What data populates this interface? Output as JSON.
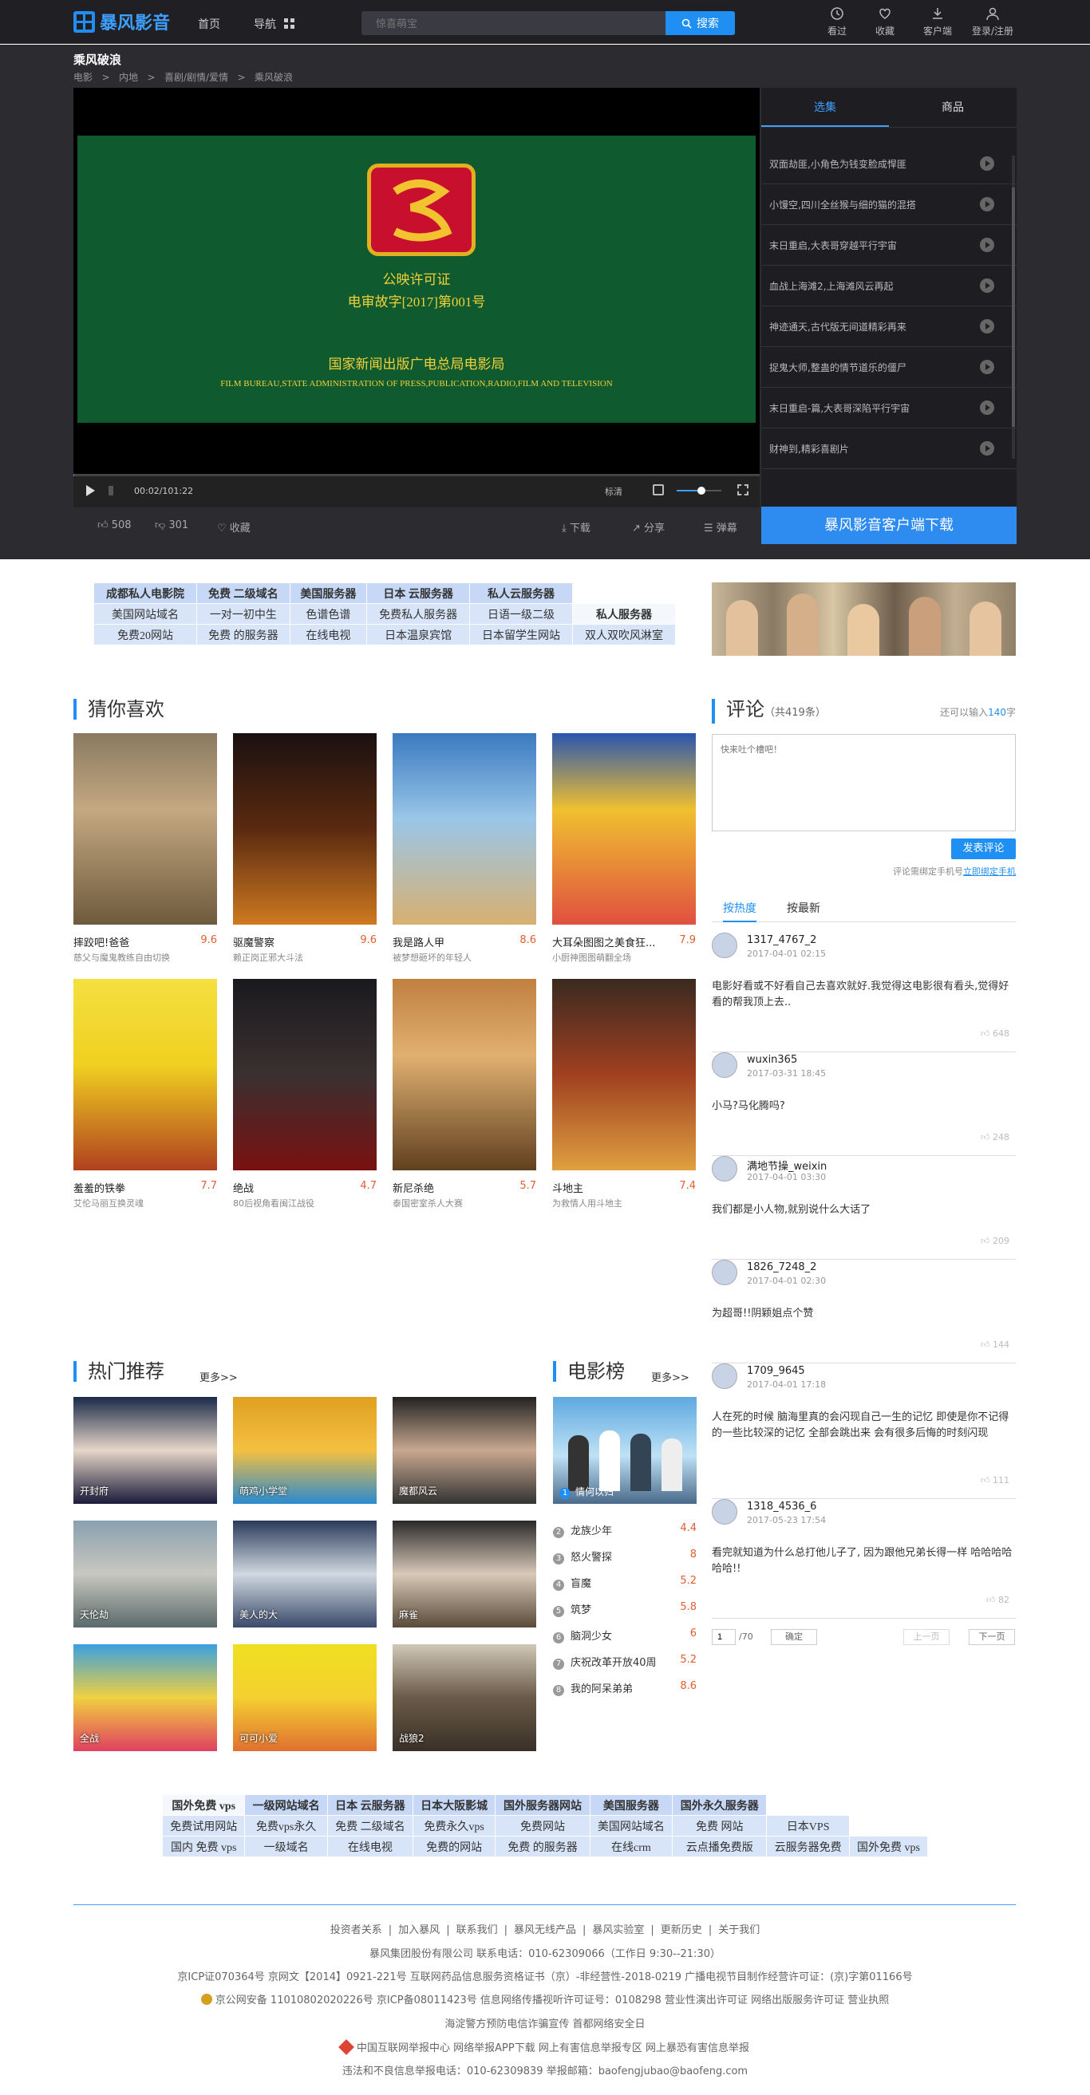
{
  "header": {
    "brand": "暴风影音",
    "nav_home": "首页",
    "nav_guide": "导航",
    "search_placeholder": "惊喜萌宝",
    "search_button": "搜索",
    "icons": [
      {
        "label": "看过",
        "icon": "clock-icon"
      },
      {
        "label": "收藏",
        "icon": "heart-icon"
      },
      {
        "label": "客户端",
        "icon": "download-icon"
      },
      {
        "label": "登录/注册",
        "icon": "user-icon"
      }
    ]
  },
  "page": {
    "title": "乘风破浪",
    "breadcrumb": [
      "电影",
      ">",
      "内地",
      ">",
      "喜剧/剧情/爱情",
      ">",
      "乘风破浪"
    ]
  },
  "player": {
    "license_title": "公映许可证",
    "license_no": "电审故字[2017]第001号",
    "bureau_cn": "国家新闻出版广电总局电影局",
    "bureau_en": "FILM BUREAU,STATE ADMINISTRATION OF PRESS,PUBLICATION,RADIO,FILM AND TELEVISION",
    "time": "00:02/101:22",
    "quality": "标清",
    "volume": 0.55,
    "progress": 0.0003
  },
  "actions": {
    "likes": "508",
    "dislikes": "301",
    "favorite": "收藏",
    "download": "下载",
    "share": "分享",
    "barrage": "弹幕"
  },
  "side": {
    "tab1": "选集",
    "tab2": "商品",
    "episodes": [
      "双面劫匪,小角色为钱变脸成悍匪",
      "小馒空,四川全丝猴与细的猫的混搭",
      "末日重启,大表哥穿越平行宇宙",
      "血战上海滩2,上海滩风云再起",
      "神迹通天,古代版无间道精彩再来",
      "捉鬼大师,整蛊的情节道乐的僵尸",
      "末日重启-篇,大表哥深陷平行宇宙",
      "财神到,精彩喜剧片"
    ],
    "download_button": "暴风影音客户端下载"
  },
  "ad_top": {
    "rows": [
      [
        "成都私人电影院",
        "免费 二级域名",
        "美国服务器",
        "日本 云服务器",
        "私人云服务器"
      ],
      [
        "美国网站域名",
        "一对一初中生",
        "色谱色谱",
        "免费私人服务器",
        "日语一级二级",
        "私人服务器"
      ],
      [
        "免费20网站",
        "免费 的服务器",
        "在线电视",
        "日本温泉宾馆",
        "日本留学生网站",
        "双人双吹风淋室"
      ]
    ]
  },
  "guess": {
    "title": "猜你喜欢",
    "items": [
      {
        "title": "摔跤吧!爸爸",
        "score": "9.6",
        "desc": "慈父与魔鬼教练自由切换"
      },
      {
        "title": "驱魔警察",
        "score": "9.6",
        "desc": "赖正岗正邪大斗法"
      },
      {
        "title": "我是路人甲",
        "score": "8.6",
        "desc": "被梦想砸坏的年轻人"
      },
      {
        "title": "大耳朵图图之美食狂...",
        "score": "7.9",
        "desc": "小厨神图图萌翻全场"
      },
      {
        "title": "羞羞的铁拳",
        "score": "7.7",
        "desc": "艾伦马丽互换灵魂"
      },
      {
        "title": "绝战",
        "score": "4.7",
        "desc": "80后视角看闽江战役"
      },
      {
        "title": "新尼杀绝",
        "score": "5.7",
        "desc": "泰国密室杀人大赛"
      },
      {
        "title": "斗地主",
        "score": "7.4",
        "desc": "为救情人用斗地主"
      }
    ]
  },
  "hot": {
    "title": "热门推荐",
    "more": "更多>>",
    "items": [
      "开封府",
      "萌鸡小学堂",
      "魔都风云",
      "天伦劫",
      "美人的大",
      "麻雀",
      "全战",
      "可可小爱",
      "战狼2"
    ]
  },
  "chart": {
    "title": "电影榜",
    "more": "更多>>",
    "top": "情何以归",
    "items": [
      {
        "n": "2",
        "name": "龙族少年",
        "score": "4.4"
      },
      {
        "n": "3",
        "name": "怒火警探",
        "score": "8"
      },
      {
        "n": "4",
        "name": "盲魔",
        "score": "5.2"
      },
      {
        "n": "5",
        "name": "筑梦",
        "score": "5.8"
      },
      {
        "n": "6",
        "name": "脑洞少女",
        "score": "6"
      },
      {
        "n": "7",
        "name": "庆祝改革开放40周",
        "score": "5.2"
      },
      {
        "n": "8",
        "name": "我的阿呆弟弟",
        "score": "8.6"
      }
    ]
  },
  "comments": {
    "title": "评论",
    "count": "（共419条）",
    "remain_pre": "还可以输入",
    "remain_num": "140",
    "remain_post": "字",
    "placeholder": "快来吐个槽吧！",
    "submit": "发表评论",
    "bind_pre": "评论需绑定手机号",
    "bind_link": "立即绑定手机",
    "tab_hot": "按热度",
    "tab_new": "按最新",
    "list": [
      {
        "name": "1317_4767_2",
        "time": "2017-04-01 02:15",
        "text": "电影好看或不好看自己去喜欢就好.我觉得这电影很有看头,觉得好看的帮我顶上去..",
        "likes": "648"
      },
      {
        "name": "wuxin365",
        "time": "2017-03-31 18:45",
        "text": "小马?马化腾吗?",
        "likes": "248"
      },
      {
        "name": "满地节操_weixin",
        "time": "2017-04-01 03:30",
        "text": "我们都是小人物,就别说什么大话了",
        "likes": "209"
      },
      {
        "name": "1826_7248_2",
        "time": "2017-04-01 02:30",
        "text": "为超哥!!阴颖姐点个赞",
        "likes": "144"
      },
      {
        "name": "1709_9645",
        "time": "2017-04-01 17:18",
        "text": "人在死的时候 脑海里真的会闪现自己一生的记忆 即使是你不记得的一些比较深的记忆 全部会跳出来 会有很多后悔的时刻闪现",
        "likes": "111"
      },
      {
        "name": "1318_4536_6",
        "time": "2017-05-23 17:54",
        "text": "看完就知道为什么总打他儿子了, 因为跟他兄弟长得一样 哈哈哈哈哈哈!!",
        "likes": "82"
      }
    ],
    "page_input": "1",
    "page_total": "/70",
    "confirm": "确定",
    "prev": "上一页",
    "next": "下一页"
  },
  "ad_bottom": {
    "rows": [
      [
        "国外免费 vps",
        "一级网站域名",
        "日本 云服务器",
        "日本大阪影城",
        "国外服务器网站",
        "美国服务器",
        "国外永久服务器"
      ],
      [
        "免费试用网站",
        "免费vps永久",
        "免费 二级域名",
        "免费永久vps",
        "免费网站",
        "美国网站域名",
        "免费 网站",
        "日本VPS"
      ],
      [
        "国内 免费 vps",
        "一级域名",
        "在线电视",
        "免费的网站",
        "免费 的服务器",
        "在线crm",
        "云点播免费版",
        "云服务器免费",
        "国外免费 vps"
      ]
    ]
  },
  "footer": {
    "links": [
      "投资者关系",
      "|",
      "加入暴风",
      "|",
      "联系我们",
      "|",
      "暴风无线产品",
      "|",
      "暴风实验室",
      "|",
      "更新历史",
      "|",
      "关于我们"
    ],
    "company": "暴风集团股份有限公司 联系电话：010-62309066（工作日 9:30--21:30）",
    "lic1": "京ICP证070364号    京网文【2014】0921-221号    互联网药品信息服务资格证书（京）-非经营性-2018-0219    广播电视节目制作经营许可证：(京)字第01166号",
    "lic2": "京公网安备 11010802020226号    京ICP备08011423号    信息网络传播视听许可证号：0108298    营业性演出许可证    网络出版服务许可证    营业执照",
    "lic3": "海淀警方预防电信诈骗宣传    首都网络安全日",
    "lic4": "中国互联网举报中心    网络举报APP下载    网上有害信息举报专区    网上暴恐有害信息举报",
    "lic5": "违法和不良信息举报电话：010-62309839    举报邮箱：baofengjubao@baofeng.com"
  }
}
